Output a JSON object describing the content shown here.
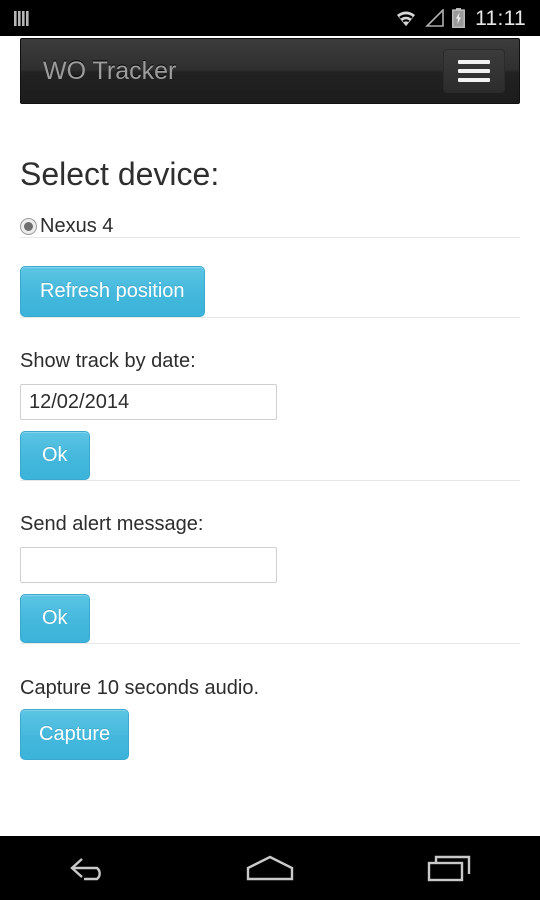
{
  "statusbar": {
    "time": "11:11",
    "icons": {
      "sim": "sim-card-icon",
      "wifi": "wifi-icon",
      "signal": "cell-signal-icon",
      "battery": "battery-charging-icon"
    }
  },
  "appbar": {
    "title": "WO Tracker",
    "menu_icon": "hamburger-menu-icon"
  },
  "main": {
    "page_title": "Select device:",
    "devices": [
      {
        "label": "Nexus 4",
        "selected": true
      }
    ],
    "refresh_button": "Refresh position",
    "track_section": {
      "label": "Show track by date:",
      "input_value": "12/02/2014",
      "input_placeholder": "",
      "ok_button": "Ok"
    },
    "alert_section": {
      "label": "Send alert message:",
      "input_value": "",
      "input_placeholder": "",
      "ok_button": "Ok"
    },
    "audio_section": {
      "label": "Capture 10 seconds audio.",
      "capture_button": "Capture"
    }
  },
  "navbar_bottom": {
    "back": "back-icon",
    "home": "home-icon",
    "recents": "recent-apps-icon"
  },
  "colors": {
    "accent": "#44b8dc",
    "appbar_bg": "#2b2b2b",
    "page_bg": "#ffffff",
    "divider": "#e8e8e8",
    "text": "#2d2d2d"
  }
}
